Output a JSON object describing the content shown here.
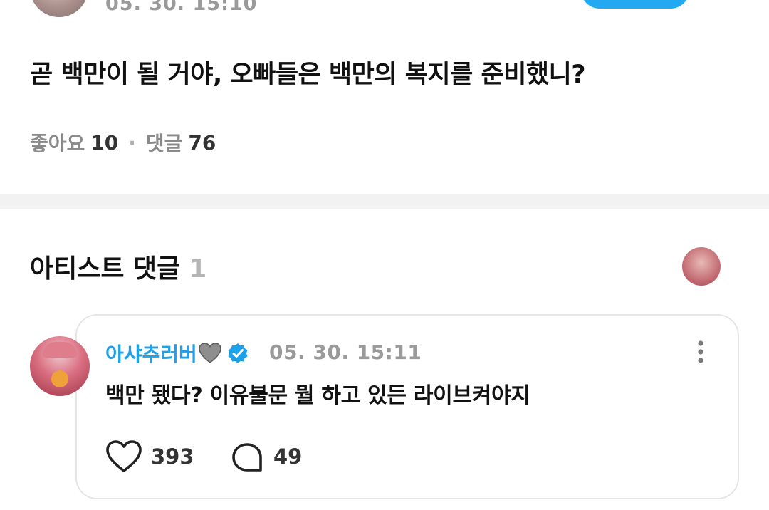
{
  "post": {
    "time": "05. 30. 15:10",
    "text": "곧 백만이 될 거야, 오빠들은 백만의 복지를 준비했니?",
    "likes_label": "좋아요",
    "likes_count": "10",
    "separator": "·",
    "comments_label": "댓글",
    "comments_count": "76",
    "follow_button_color": "#23a8f2"
  },
  "artist_comments": {
    "title": "아티스트 댓글",
    "count": "1"
  },
  "comment": {
    "author": "아샤추러버",
    "author_color": "#1fa1ea",
    "badge_icon": "verified-icon",
    "emoji_icon": "grey-heart-icon",
    "time": "05. 30. 15:11",
    "text": "백만 됐다? 이유불문 뭘 하고 있든 라이브켜야지",
    "likes": "393",
    "replies": "49"
  }
}
